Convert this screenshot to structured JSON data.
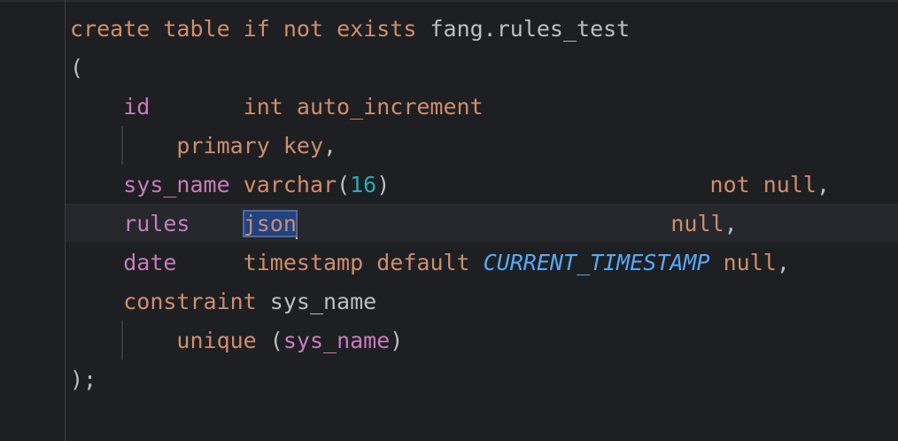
{
  "code_lines": [
    {
      "tokens": [
        {
          "t": "create",
          "cls": "kw"
        },
        {
          "t": " "
        },
        {
          "t": "table",
          "cls": "kw"
        },
        {
          "t": " "
        },
        {
          "t": "if",
          "cls": "kw"
        },
        {
          "t": " "
        },
        {
          "t": "not",
          "cls": "kw"
        },
        {
          "t": " "
        },
        {
          "t": "exists",
          "cls": "kw"
        },
        {
          "t": " "
        },
        {
          "t": "fang.rules_test",
          "cls": "id"
        }
      ]
    },
    {
      "tokens": [
        {
          "t": "(",
          "cls": "id"
        }
      ]
    },
    {
      "tokens": [
        {
          "t": "    "
        },
        {
          "t": "id",
          "cls": "col"
        },
        {
          "t": "       "
        },
        {
          "t": "int",
          "cls": "kw"
        },
        {
          "t": " "
        },
        {
          "t": "auto_increment",
          "cls": "kw"
        }
      ]
    },
    {
      "tokens": [
        {
          "t": "        "
        },
        {
          "t": "primary",
          "cls": "kw"
        },
        {
          "t": " "
        },
        {
          "t": "key",
          "cls": "kw"
        },
        {
          "t": ",",
          "cls": "id"
        }
      ]
    },
    {
      "tokens": [
        {
          "t": "    "
        },
        {
          "t": "sys_name",
          "cls": "col"
        },
        {
          "t": " "
        },
        {
          "t": "varchar",
          "cls": "kw"
        },
        {
          "t": "(",
          "cls": "id"
        },
        {
          "t": "16",
          "cls": "num"
        },
        {
          "t": ")",
          "cls": "id"
        },
        {
          "t": "                        "
        },
        {
          "t": "not",
          "cls": "kw"
        },
        {
          "t": " "
        },
        {
          "t": "null",
          "cls": "kw"
        },
        {
          "t": ",",
          "cls": "id"
        }
      ]
    },
    {
      "tokens": [
        {
          "t": "    "
        },
        {
          "t": "rules",
          "cls": "col"
        },
        {
          "t": "    "
        },
        {
          "t": "json",
          "cls": "kw sel",
          "caret": true
        },
        {
          "t": "                            "
        },
        {
          "t": "null",
          "cls": "kw"
        },
        {
          "t": ",",
          "cls": "id"
        }
      ]
    },
    {
      "tokens": [
        {
          "t": "    "
        },
        {
          "t": "date",
          "cls": "col"
        },
        {
          "t": "     "
        },
        {
          "t": "timestamp",
          "cls": "kw"
        },
        {
          "t": " "
        },
        {
          "t": "default",
          "cls": "kw"
        },
        {
          "t": " "
        },
        {
          "t": "CURRENT_TIMESTAMP",
          "cls": "fn"
        },
        {
          "t": " "
        },
        {
          "t": "null",
          "cls": "kw"
        },
        {
          "t": ",",
          "cls": "id"
        }
      ]
    },
    {
      "tokens": [
        {
          "t": "    "
        },
        {
          "t": "constraint",
          "cls": "kw"
        },
        {
          "t": " "
        },
        {
          "t": "sys_name",
          "cls": "id"
        }
      ]
    },
    {
      "tokens": [
        {
          "t": "        "
        },
        {
          "t": "unique",
          "cls": "kw"
        },
        {
          "t": " "
        },
        {
          "t": "(",
          "cls": "id"
        },
        {
          "t": "sys_name",
          "cls": "col"
        },
        {
          "t": ")",
          "cls": "id"
        }
      ]
    },
    {
      "tokens": [
        {
          "t": ");",
          "cls": "id"
        }
      ]
    }
  ],
  "colors": {
    "background": "#1e1f22",
    "keyword": "#cf8e6d",
    "column": "#c77dbb",
    "number": "#2aacb8",
    "function": "#56a8f5",
    "identifier": "#bcbec4",
    "selection": "#214283"
  }
}
